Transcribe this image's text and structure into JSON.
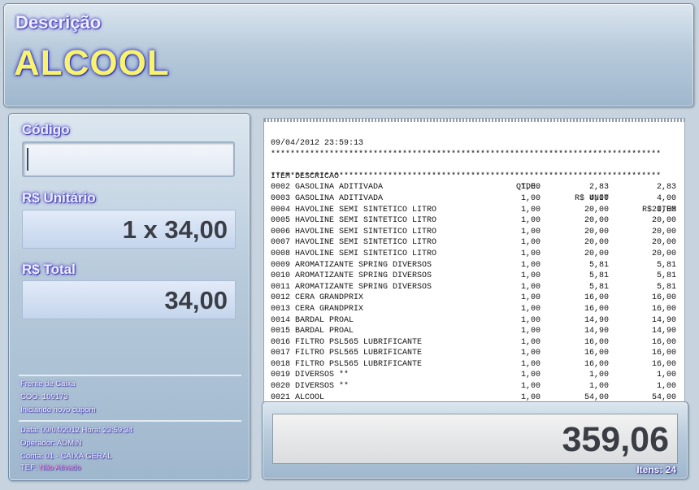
{
  "header": {
    "descricao_label": "Descrição",
    "descricao_value": "ALCOOL"
  },
  "left": {
    "codigo_label": "Código",
    "codigo_value": "",
    "unitario_label": "R$ Unitário",
    "unitario_value": "1 x 34,00",
    "total_label": "R$ Total",
    "total_value": "34,00",
    "status": {
      "line1": "Frente de Caixa",
      "line2": "COO:  109173",
      "line3": "Iniciando novo cupom"
    },
    "session": {
      "data_line": "Data:  09/04/2012    Hora: 23:59:34",
      "operador_line": "Operador:  ADMIN",
      "conta_line": "Conta:  01 - CAIXA GERAL",
      "tef_label": "TEF:",
      "tef_value": "Não Ativado"
    }
  },
  "receipt": {
    "datetime": "09/04/2012 23:59:13",
    "stars": "********************************************************************************",
    "headers": {
      "item": "ITEM DESCRICAO",
      "qty": "QTDE.",
      "unit": "R$ UNIT",
      "total": "R$ ITEM"
    },
    "items": [
      {
        "item": "0002 GASOLINA ADITIVADA",
        "qty": "1,00",
        "unit": "2,83",
        "total": "2,83"
      },
      {
        "item": "0003 GASOLINA ADITIVADA",
        "qty": "1,00",
        "unit": "4,00",
        "total": "4,00"
      },
      {
        "item": "0004 HAVOLINE SEMI SINTETICO LITRO",
        "qty": "1,00",
        "unit": "20,00",
        "total": "20,00"
      },
      {
        "item": "0005 HAVOLINE SEMI SINTETICO LITRO",
        "qty": "1,00",
        "unit": "20,00",
        "total": "20,00"
      },
      {
        "item": "0006 HAVOLINE SEMI SINTETICO LITRO",
        "qty": "1,00",
        "unit": "20,00",
        "total": "20,00"
      },
      {
        "item": "0007 HAVOLINE SEMI SINTETICO LITRO",
        "qty": "1,00",
        "unit": "20,00",
        "total": "20,00"
      },
      {
        "item": "0008 HAVOLINE SEMI SINTETICO LITRO",
        "qty": "1,00",
        "unit": "20,00",
        "total": "20,00"
      },
      {
        "item": "0009 AROMATIZANTE SPRING DIVERSOS",
        "qty": "1,00",
        "unit": "5,81",
        "total": "5,81"
      },
      {
        "item": "0010 AROMATIZANTE SPRING DIVERSOS",
        "qty": "1,00",
        "unit": "5,81",
        "total": "5,81"
      },
      {
        "item": "0011 AROMATIZANTE SPRING DIVERSOS",
        "qty": "1,00",
        "unit": "5,81",
        "total": "5,81"
      },
      {
        "item": "0012 CERA GRANDPRIX",
        "qty": "1,00",
        "unit": "16,00",
        "total": "16,00"
      },
      {
        "item": "0013 CERA GRANDPRIX",
        "qty": "1,00",
        "unit": "16,00",
        "total": "16,00"
      },
      {
        "item": "0014 BARDAL PROAL",
        "qty": "1,00",
        "unit": "14,90",
        "total": "14,90"
      },
      {
        "item": "0015 BARDAL PROAL",
        "qty": "1,00",
        "unit": "14,90",
        "total": "14,90"
      },
      {
        "item": "0016 FILTRO PSL565 LUBRIFICANTE",
        "qty": "1,00",
        "unit": "16,00",
        "total": "16,00"
      },
      {
        "item": "0017 FILTRO PSL565 LUBRIFICANTE",
        "qty": "1,00",
        "unit": "16,00",
        "total": "16,00"
      },
      {
        "item": "0018 FILTRO PSL565 LUBRIFICANTE",
        "qty": "1,00",
        "unit": "16,00",
        "total": "16,00"
      },
      {
        "item": "0019 DIVERSOS **",
        "qty": "1,00",
        "unit": "1,00",
        "total": "1,00"
      },
      {
        "item": "0020 DIVERSOS **",
        "qty": "1,00",
        "unit": "1,00",
        "total": "1,00"
      },
      {
        "item": "0021 ALCOOL",
        "qty": "1,00",
        "unit": "54,00",
        "total": "54,00"
      }
    ]
  },
  "footer": {
    "grand_total": "359,06",
    "itens_label": "Itens: 24"
  }
}
